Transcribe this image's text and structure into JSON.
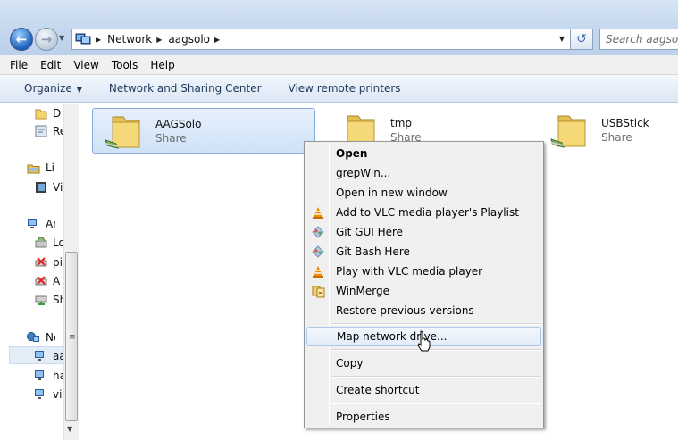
{
  "address_bar": {
    "crumbs": [
      "Network",
      "aagsolo"
    ],
    "search_placeholder": "Search aagsolo"
  },
  "menu_bar": [
    "File",
    "Edit",
    "View",
    "Tools",
    "Help"
  ],
  "command_bar": {
    "organize": "Organize",
    "network_center": "Network and Sharing Center",
    "remote_printers": "View remote printers"
  },
  "nav_pane": {
    "items": [
      "D",
      "Re",
      "Libr",
      "Vi",
      "Ani",
      "Lo",
      "pi",
      "A",
      "Sh",
      "Net",
      "aa",
      "ha",
      "vi"
    ]
  },
  "tiles": [
    {
      "name": "AAGSolo",
      "sub": "Share"
    },
    {
      "name": "tmp",
      "sub": "Share"
    },
    {
      "name": "USBStick",
      "sub": "Share"
    }
  ],
  "context_menu": {
    "items": [
      {
        "label": "Open",
        "icon": "none"
      },
      {
        "label": "grepWin...",
        "icon": "none"
      },
      {
        "label": "Open in new window",
        "icon": "none"
      },
      {
        "label": "Add to VLC media player's Playlist",
        "icon": "vlc-cone-icon"
      },
      {
        "label": "Git GUI Here",
        "icon": "git-icon"
      },
      {
        "label": "Git Bash Here",
        "icon": "git-icon"
      },
      {
        "label": "Play with VLC media player",
        "icon": "vlc-cone-icon"
      },
      {
        "label": "WinMerge",
        "icon": "winmerge-icon"
      },
      {
        "label": "Restore previous versions",
        "icon": "none"
      },
      {
        "label": "Map network drive...",
        "icon": "none"
      },
      {
        "label": "Copy",
        "icon": "none"
      },
      {
        "label": "Create shortcut",
        "icon": "none"
      },
      {
        "label": "Properties",
        "icon": "none"
      }
    ]
  },
  "colors": {
    "accent": "#1d5fb8",
    "selection": "#cfe2f8",
    "vlc_orange": "#f08a00",
    "folder_yellow": "#f3d36b"
  }
}
